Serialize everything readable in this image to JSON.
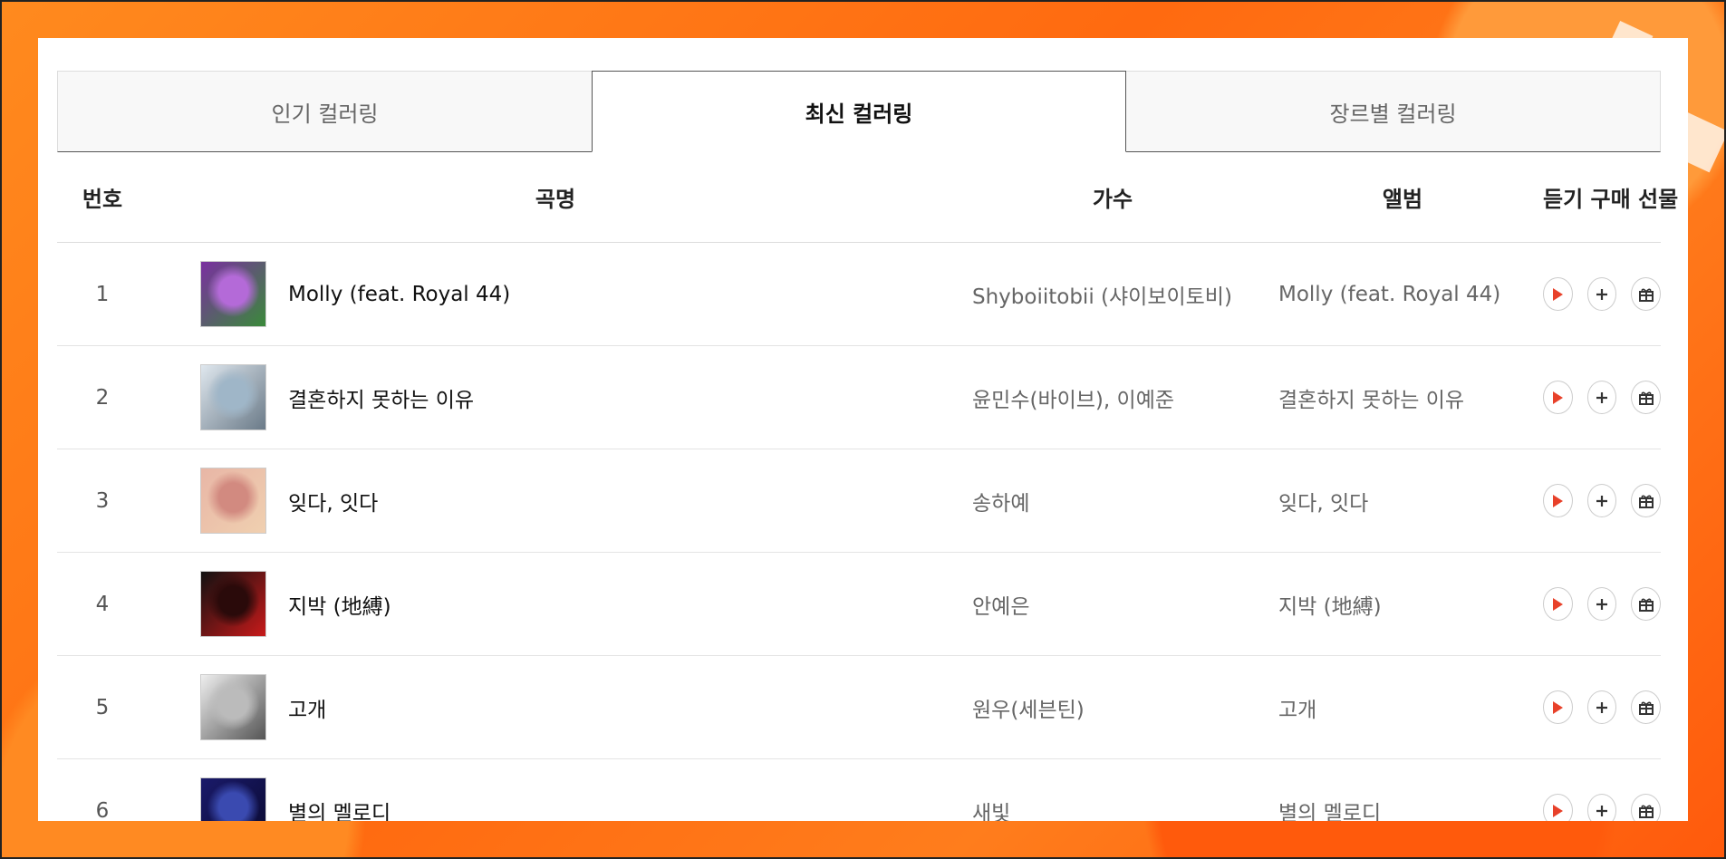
{
  "tabs": [
    {
      "label": "인기 컬러링",
      "active": false
    },
    {
      "label": "최신 컬러링",
      "active": true
    },
    {
      "label": "장르별 컬러링",
      "active": false
    }
  ],
  "table": {
    "headers": {
      "number": "번호",
      "title": "곡명",
      "artist": "가수",
      "album": "앨범",
      "actions": "듣기 구매 선물"
    },
    "rows": [
      {
        "number": "1",
        "title": "Molly (feat. Royal 44)",
        "artist": "Shyboiitobii (샤이보이토비)",
        "album": "Molly (feat. Royal 44)",
        "cover_colors": [
          "#7a2fa0",
          "#b46ad8",
          "#3a8a3a"
        ]
      },
      {
        "number": "2",
        "title": "결혼하지 못하는 이유",
        "artist": "윤민수(바이브), 이예준",
        "album": "결혼하지 못하는 이유",
        "cover_colors": [
          "#dfe7ee",
          "#9fb6c8",
          "#6a7a88"
        ]
      },
      {
        "number": "3",
        "title": "잊다, 잇다",
        "artist": "송하예",
        "album": "잊다, 잇다",
        "cover_colors": [
          "#e8b6a6",
          "#d28a80",
          "#f0d0b0"
        ]
      },
      {
        "number": "4",
        "title": "지박 (地縛)",
        "artist": "안예은",
        "album": "지박 (地縛)",
        "cover_colors": [
          "#111111",
          "#2a0a0a",
          "#c81a1a"
        ]
      },
      {
        "number": "5",
        "title": "고개",
        "artist": "원우(세븐틴)",
        "album": "고개",
        "cover_colors": [
          "#eeeeee",
          "#bbbbbb",
          "#555555"
        ]
      },
      {
        "number": "6",
        "title": "별의 멜로디",
        "artist": "새빛",
        "album": "별의 멜로디",
        "cover_colors": [
          "#1a1a6a",
          "#3a4ab0",
          "#0a0a30"
        ]
      }
    ]
  },
  "colors": {
    "background": "#ff7a1a",
    "play_icon": "#e8412a",
    "icon_gray": "#333333"
  },
  "icons": {
    "play": "play-icon",
    "buy": "plus-icon",
    "gift": "gift-icon"
  }
}
